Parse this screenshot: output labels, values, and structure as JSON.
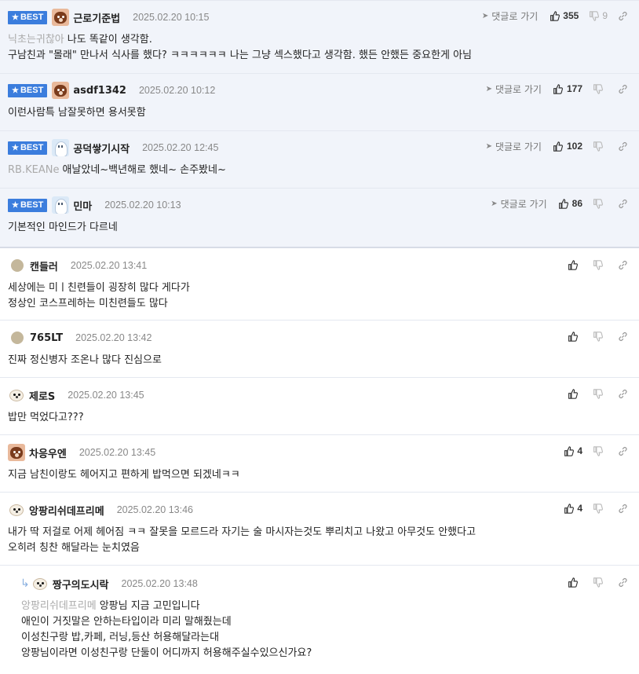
{
  "ui": {
    "best_label": "BEST",
    "goto_label": "댓글로 가기"
  },
  "best_comments": [
    {
      "nick": "근로기준법",
      "time": "2025.02.20 10:15",
      "avatar": "bear-avatar",
      "likes": "355",
      "dislikes": "9",
      "mention": "닉초는귀찮아",
      "lines": [
        "나도 똑같이 생각함.",
        "구남친과 \"몰래\" 만나서 식사를 했다? ㅋㅋㅋㅋㅋㅋ 나는 그냥 섹스했다고 생각함. 했든 안했든 중요한게 아님"
      ]
    },
    {
      "nick": "asdf1342",
      "time": "2025.02.20 10:12",
      "avatar": "bear-avatar",
      "likes": "177",
      "dislikes": "",
      "mention": "",
      "lines": [
        "이런사람특 남잘못하면 용서못함"
      ]
    },
    {
      "nick": "공덕쌓기시작",
      "time": "2025.02.20 12:45",
      "avatar": "ghost-avatar",
      "likes": "102",
      "dislikes": "",
      "mention": "RB.KEANe",
      "lines": [
        "애날았네~백년해로 했네~ 손주봤네~"
      ]
    },
    {
      "nick": "민마",
      "time": "2025.02.20 10:13",
      "avatar": "ghost-avatar",
      "likes": "86",
      "dislikes": "",
      "mention": "",
      "lines": [
        "기본적인 마인드가 다르네"
      ]
    }
  ],
  "comments": [
    {
      "nick": "캔들러",
      "time": "2025.02.20 13:41",
      "likes": "",
      "lines": [
        "세상에는 미ㅣ친련들이 굉장히 많다 게다가",
        "정상인 코스프레하는 미친련들도 많다"
      ]
    },
    {
      "nick": "765LT",
      "time": "2025.02.20 13:42",
      "likes": "",
      "lines": [
        "진짜 정신병자 조온나 많다 진심으로"
      ]
    },
    {
      "nick": "제로S",
      "time": "2025.02.20 13:45",
      "likes": "",
      "lines": [
        "밥만 먹었다고???"
      ]
    },
    {
      "nick": "차응우엔",
      "time": "2025.02.20 13:45",
      "likes": "4",
      "lines": [
        "지금 남친이랑도 헤어지고 편하게 밥먹으면 되겠네ㅋㅋ"
      ]
    },
    {
      "nick": "앙팡리쉬데프리메",
      "time": "2025.02.20 13:46",
      "likes": "4",
      "lines": [
        "내가 딱 저걸로 어제 헤어짐 ㅋㅋ 잘못을 모르드라 자기는 술 마시자는것도 뿌리치고 나왔고 아무것도 안했다고",
        "오히려 칭찬 해달라는 눈치였음"
      ]
    }
  ],
  "reply": {
    "nick": "짱구의도시락",
    "time": "2025.02.20 13:48",
    "mention": "앙팡리쉬데프리메",
    "lines": [
      "앙팡님 지금 고민입니다",
      "애인이 거짓말은 안하는타입이라 미리 말해줬는데",
      "이성친구랑 밥,카페, 러닝,등산 허용해달라는대",
      "앙팡님이라면 이성친구랑 단둘이 어디까지 허용해주실수있으신가요?"
    ]
  }
}
